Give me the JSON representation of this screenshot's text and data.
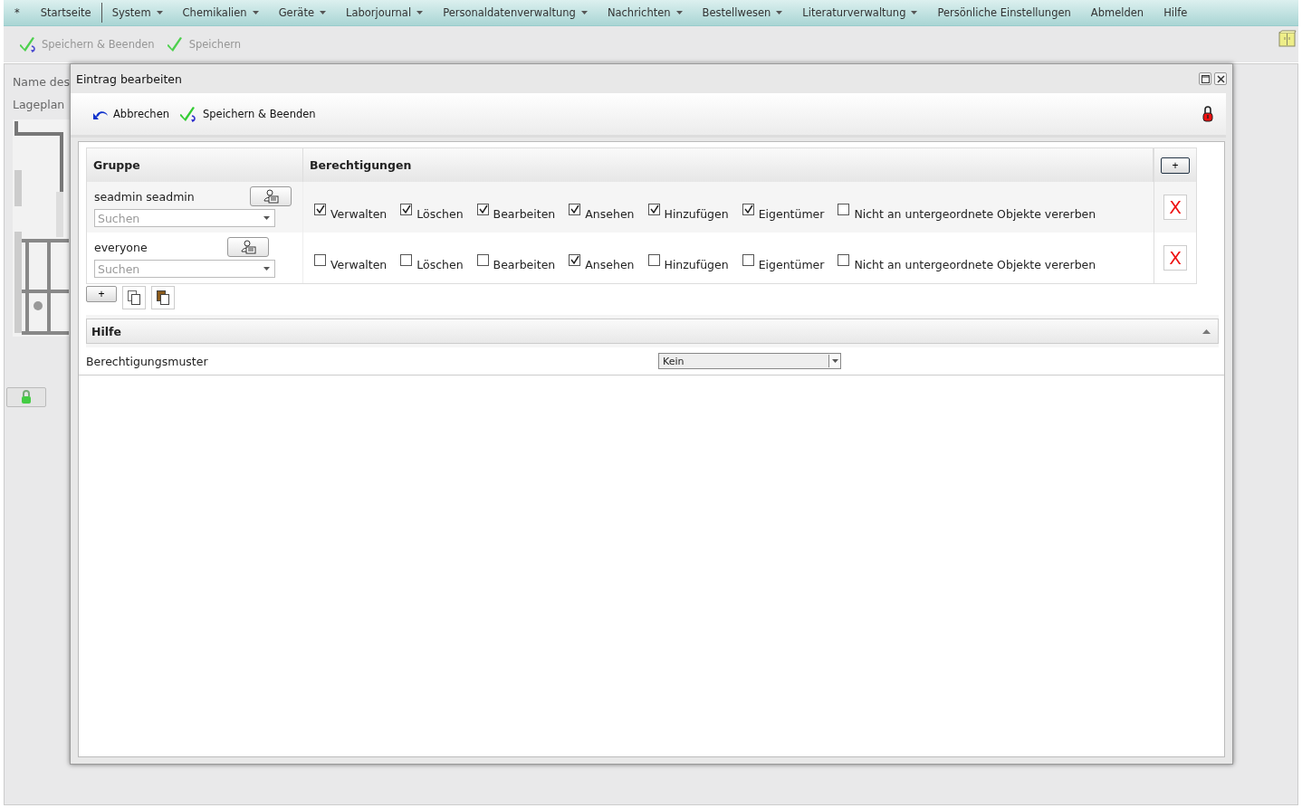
{
  "menu": [
    {
      "label": "*",
      "dropdown": false
    },
    {
      "label": "Startseite",
      "dropdown": false
    },
    {
      "label": "System",
      "dropdown": true
    },
    {
      "label": "Chemikalien",
      "dropdown": true
    },
    {
      "label": "Geräte",
      "dropdown": true
    },
    {
      "label": "Laborjournal",
      "dropdown": true
    },
    {
      "label": "Personaldatenverwaltung",
      "dropdown": true
    },
    {
      "label": "Nachrichten",
      "dropdown": true
    },
    {
      "label": "Bestellwesen",
      "dropdown": true
    },
    {
      "label": "Literaturverwaltung",
      "dropdown": true
    },
    {
      "label": "Persönliche Einstellungen",
      "dropdown": false
    },
    {
      "label": "Abmelden",
      "dropdown": false
    },
    {
      "label": "Hilfe",
      "dropdown": false
    }
  ],
  "toolbar": [
    {
      "label": "Speichern & Beenden",
      "kind": "save-close"
    },
    {
      "label": "Speichern",
      "kind": "save"
    }
  ],
  "background": {
    "name_label": "Name des",
    "plan_label": "Lageplan"
  },
  "dialog": {
    "title": "Eintrag bearbeiten",
    "actions": [
      {
        "label": "Abbrechen",
        "kind": "cancel"
      },
      {
        "label": "Speichern & Beenden",
        "kind": "save-close"
      }
    ],
    "columns": [
      "Gruppe",
      "Berechtigungen"
    ],
    "add_column_button": "+",
    "rows": [
      {
        "group": "seadmin seadmin",
        "search_placeholder": "Suchen",
        "delete": "X",
        "permissions": [
          {
            "label": "Verwalten",
            "checked": true
          },
          {
            "label": "Löschen",
            "checked": true
          },
          {
            "label": "Bearbeiten",
            "checked": true
          },
          {
            "label": "Ansehen",
            "checked": true
          },
          {
            "label": "Hinzufügen",
            "checked": true
          },
          {
            "label": "Eigentümer",
            "checked": true
          },
          {
            "label": "Nicht an untergeordnete Objekte vererben",
            "checked": false
          }
        ]
      },
      {
        "group": "everyone",
        "search_placeholder": "Suchen",
        "delete": "X",
        "permissions": [
          {
            "label": "Verwalten",
            "checked": false
          },
          {
            "label": "Löschen",
            "checked": false
          },
          {
            "label": "Bearbeiten",
            "checked": false
          },
          {
            "label": "Ansehen",
            "checked": true
          },
          {
            "label": "Hinzufügen",
            "checked": false
          },
          {
            "label": "Eigentümer",
            "checked": false
          },
          {
            "label": "Nicht an untergeordnete Objekte vererben",
            "checked": false
          }
        ]
      }
    ],
    "add_row_button": "+",
    "help": {
      "title": "Hilfe",
      "expanded": true
    },
    "template": {
      "label": "Berechtigungsmuster",
      "value": "Kein"
    }
  }
}
